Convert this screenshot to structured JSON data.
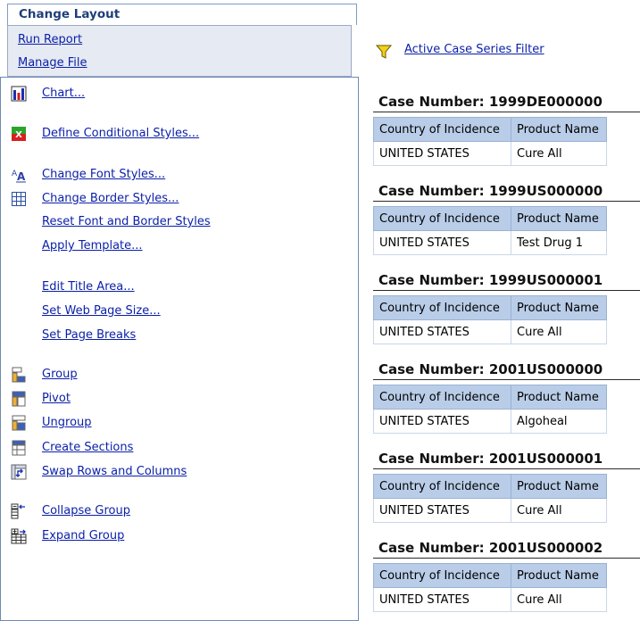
{
  "panel": {
    "header": "Change Layout",
    "run_report": "Run Report",
    "manage_file": "Manage File"
  },
  "menu": {
    "chart": "Chart...",
    "conditional_styles": "Define Conditional Styles...",
    "font_styles": "Change Font Styles...",
    "border_styles": "Change Border Styles...",
    "reset_styles": "Reset Font and Border Styles",
    "apply_template": "Apply Template...",
    "edit_title": "Edit Title Area...",
    "web_page_size": "Set Web Page Size...",
    "page_breaks": "Set Page Breaks",
    "group": "Group",
    "pivot": "Pivot",
    "ungroup": "Ungroup",
    "create_sections": "Create Sections",
    "swap_rows_columns": "Swap Rows and Columns",
    "collapse_group": "Collapse Group",
    "expand_group": "Expand Group"
  },
  "icons": {
    "chart": "bar-chart-icon",
    "conditional": "conditional-style-icon",
    "font": "font-style-icon",
    "border": "border-grid-icon",
    "group": "group-icon",
    "pivot": "pivot-icon",
    "ungroup": "ungroup-icon",
    "sections": "sections-icon",
    "swap": "swap-icon",
    "collapse": "collapse-group-icon",
    "expand": "expand-group-icon",
    "filter": "funnel-icon"
  },
  "filter": {
    "label": "Active Case Series Filter"
  },
  "table_headers": {
    "country": "Country of Incidence",
    "product": "Product Name"
  },
  "cases": [
    {
      "title": "Case Number: 1999DE000000",
      "country": "UNITED STATES",
      "product": "Cure All"
    },
    {
      "title": "Case Number: 1999US000000",
      "country": "UNITED STATES",
      "product": "Test Drug 1"
    },
    {
      "title": "Case Number: 1999US000001",
      "country": "UNITED STATES",
      "product": "Cure All"
    },
    {
      "title": "Case Number: 2001US000000",
      "country": "UNITED STATES",
      "product": "Algoheal"
    },
    {
      "title": "Case Number: 2001US000001",
      "country": "UNITED STATES",
      "product": "Cure All"
    },
    {
      "title": "Case Number: 2001US000002",
      "country": "UNITED STATES",
      "product": "Cure All"
    }
  ],
  "colors": {
    "link": "#0a1fa8",
    "header_text": "#1f3f78",
    "panel_border": "#6f8ab4",
    "table_header_bg": "#b9cde8",
    "run_box_bg": "#e6eaf2"
  }
}
